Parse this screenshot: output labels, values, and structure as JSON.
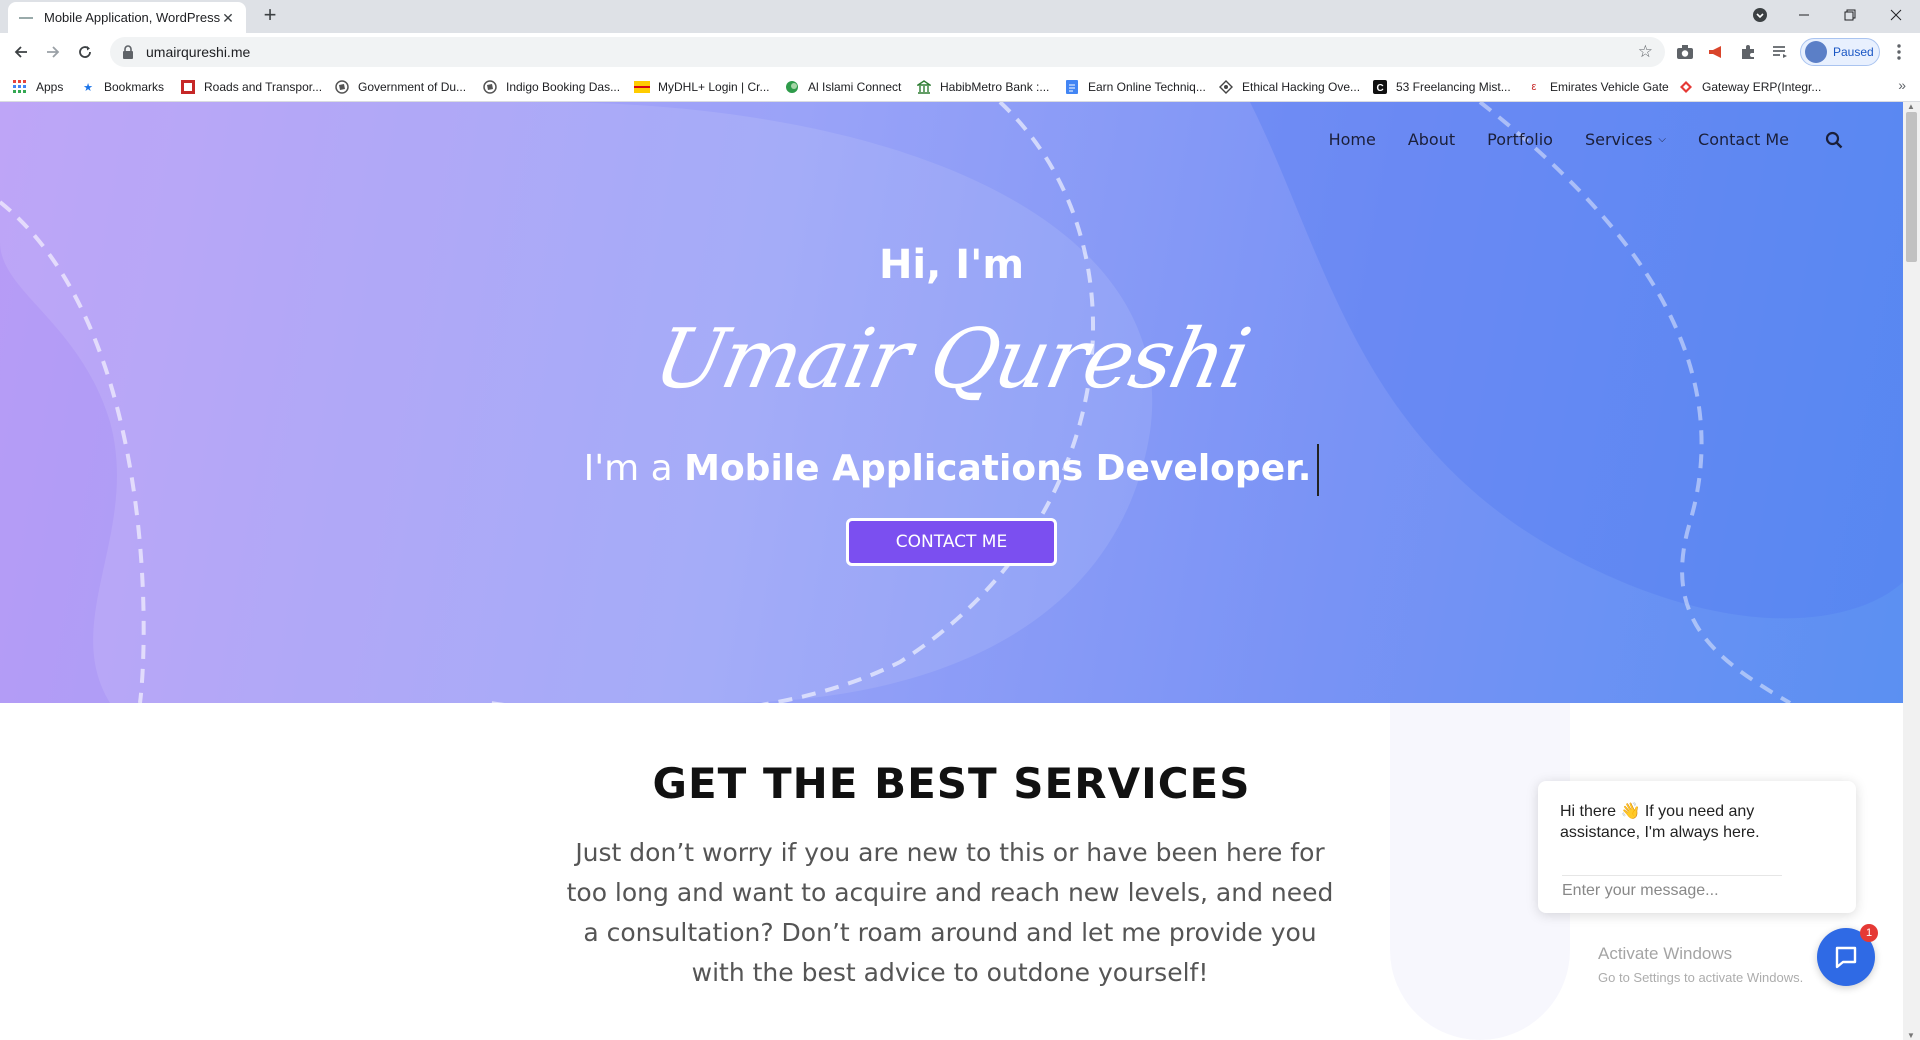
{
  "browser": {
    "tab_title": "Mobile Application, WordPress D",
    "url": "umairqureshi.me",
    "profile_label": "Paused"
  },
  "bookmarks": {
    "apps": "Apps",
    "items": [
      "Bookmarks",
      "Roads and Transpor...",
      "Government of Du...",
      "Indigo Booking Das...",
      "MyDHL+ Login | Cr...",
      "Al Islami Connect",
      "HabibMetro Bank :...",
      "Earn Online Techniq...",
      "Ethical Hacking Ove...",
      "53 Freelancing Mist...",
      "Emirates Vehicle Gate",
      "Gateway ERP(Integr..."
    ]
  },
  "site_nav": {
    "home": "Home",
    "about": "About",
    "portfolio": "Portfolio",
    "services": "Services",
    "contact": "Contact Me"
  },
  "hero": {
    "greeting": "Hi, I'm",
    "name": "Umair Qureshi",
    "tagline_prefix": "I'm a",
    "tagline_role": "Mobile Applications Developer.",
    "cta": "CONTACT ME"
  },
  "services": {
    "title": "GET THE BEST SERVICES",
    "body": "Just don’t worry if you are new to this or have been here for too long and want to acquire and reach new levels, and need a consultation? Don’t roam around and let me provide you with the best advice to outdone yourself!"
  },
  "chat": {
    "message": "Hi there 👋 If you need any assistance, I'm always here.",
    "placeholder": "Enter your message...",
    "badge": "1"
  },
  "watermark": {
    "title": "Activate Windows",
    "subtitle": "Go to Settings to activate Windows."
  }
}
